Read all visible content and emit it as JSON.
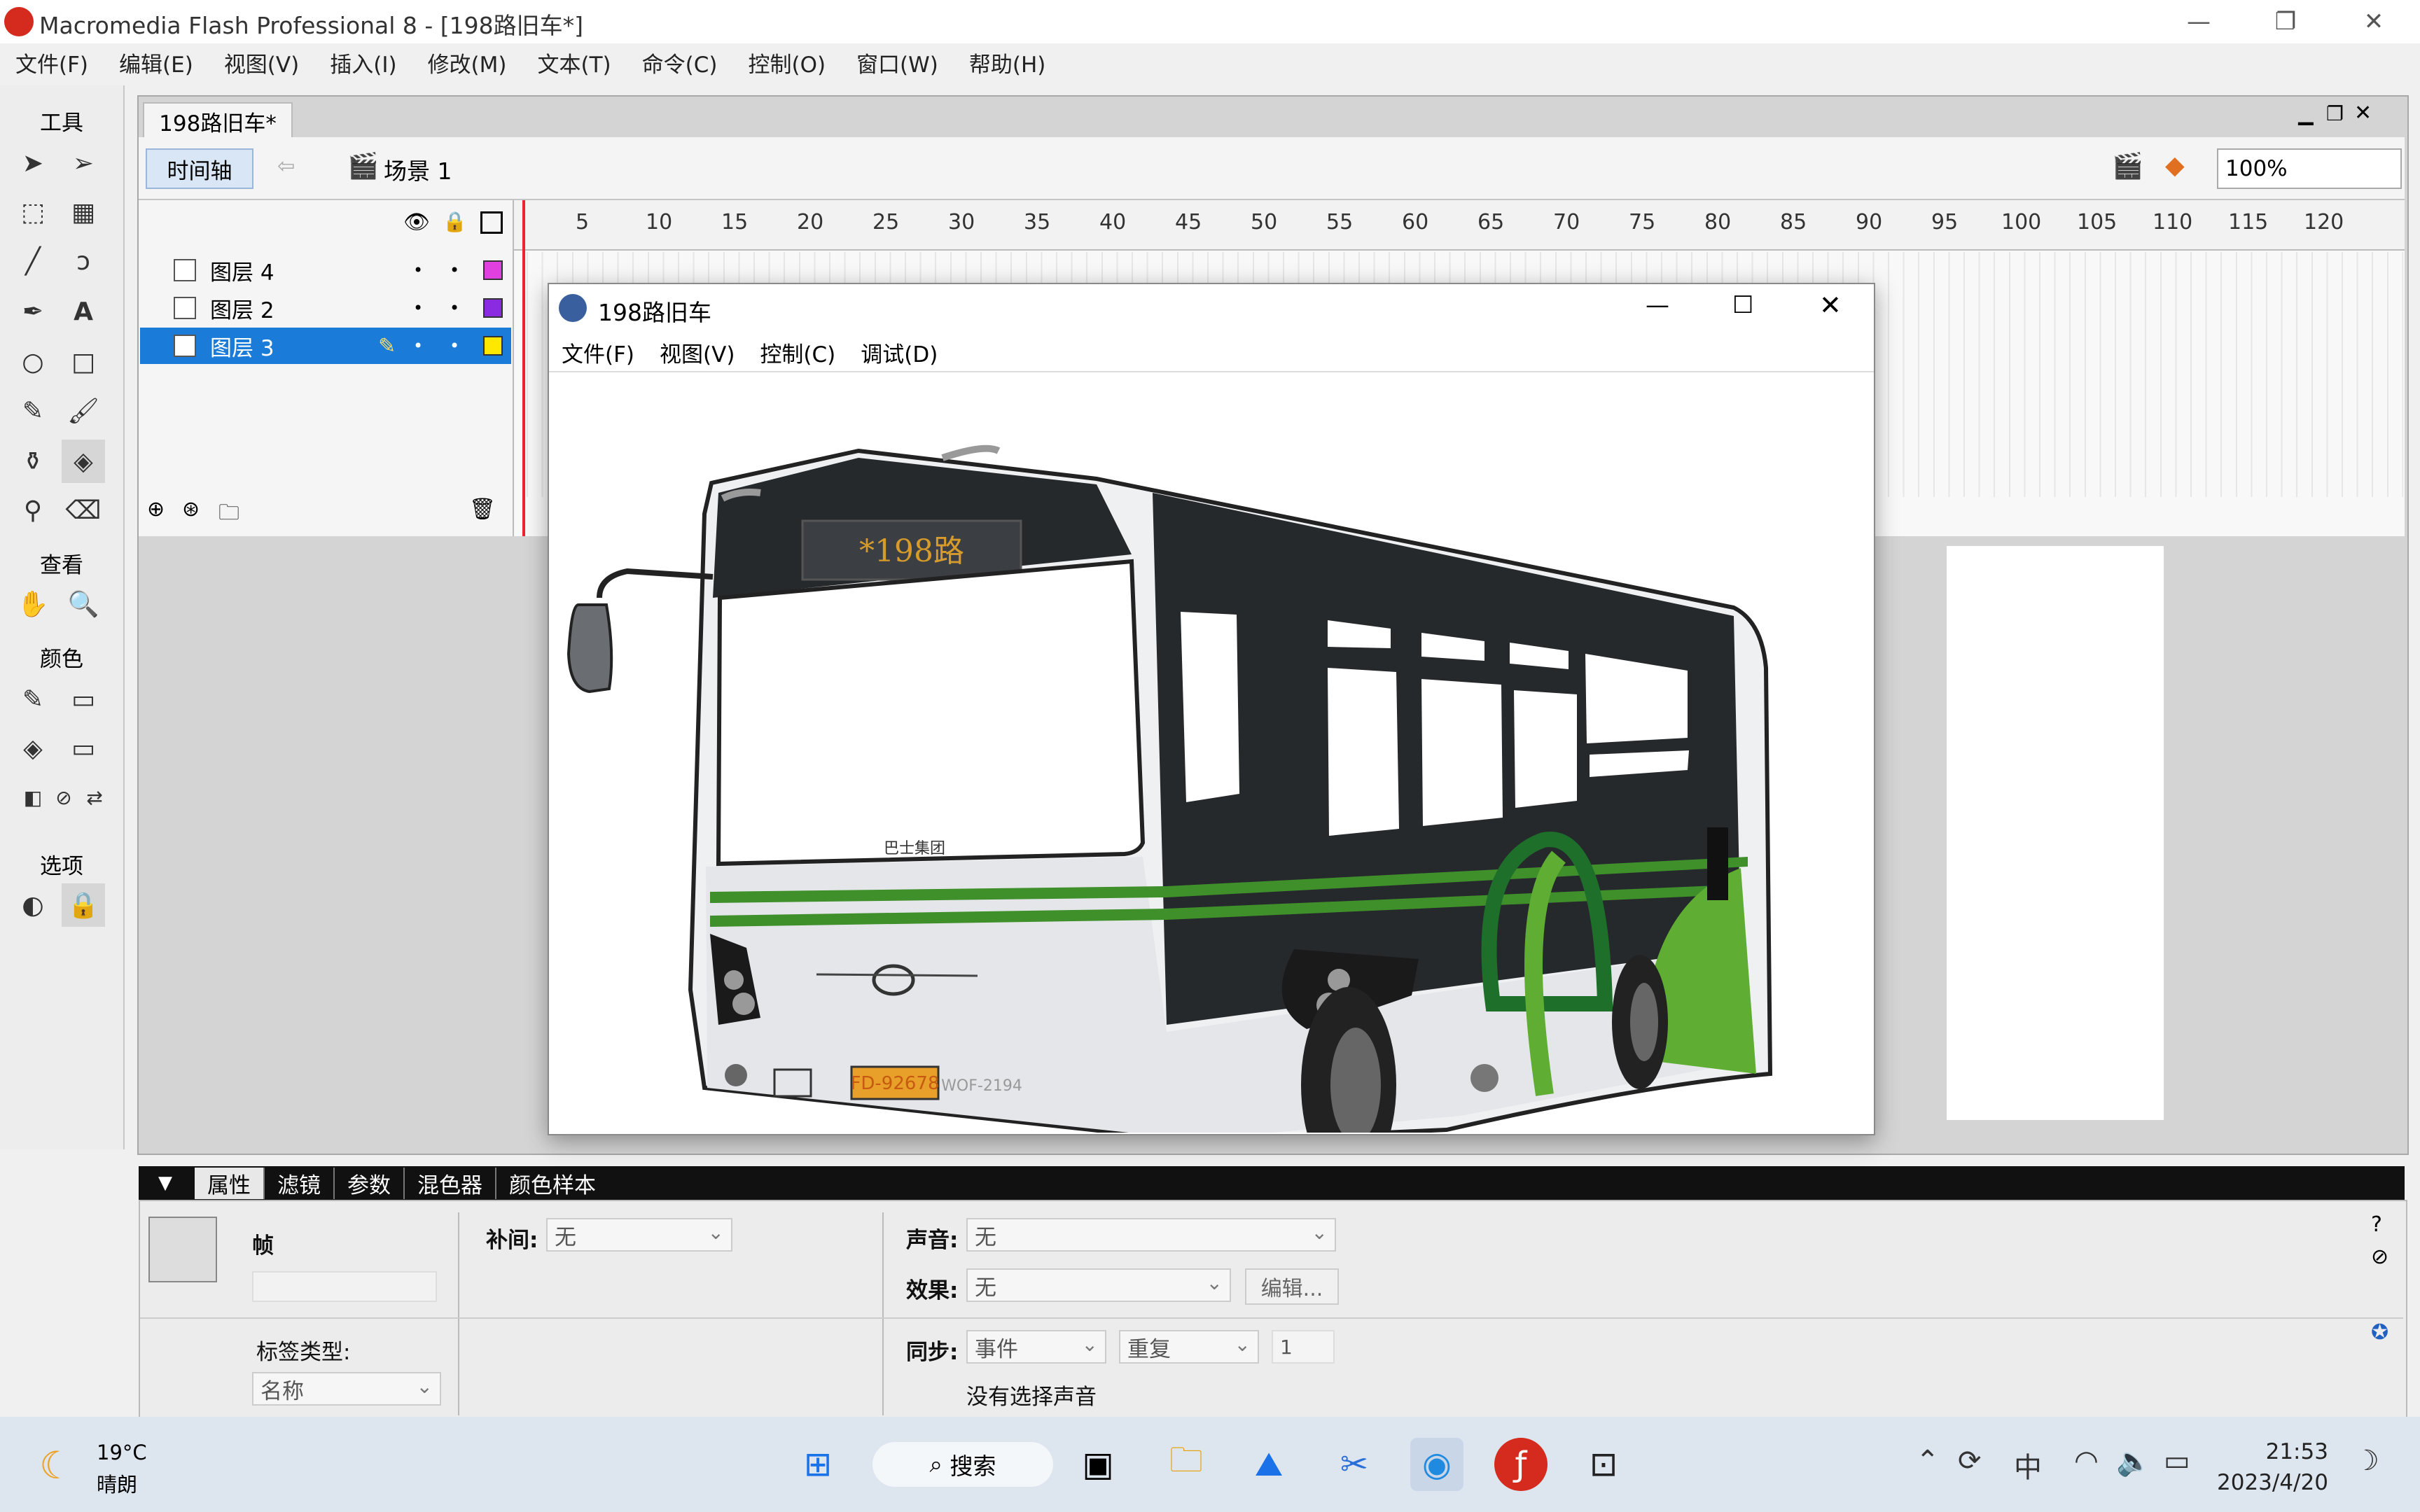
{
  "window": {
    "title": "Macromedia Flash Professional 8 - [198路旧车*]"
  },
  "menubar": [
    "文件(F)",
    "编辑(E)",
    "视图(V)",
    "插入(I)",
    "修改(M)",
    "文本(T)",
    "命令(C)",
    "控制(O)",
    "窗口(W)",
    "帮助(H)"
  ],
  "tools": {
    "header_tools": "工具",
    "header_view": "查看",
    "header_colors": "颜色",
    "header_options": "选项"
  },
  "document": {
    "tab": "198路旧车*",
    "timeline_button": "时间轴",
    "scene": "场景 1",
    "zoom": "100%"
  },
  "timeline": {
    "ruler": [
      "5",
      "10",
      "15",
      "20",
      "25",
      "30",
      "35",
      "40",
      "45",
      "50",
      "55",
      "60",
      "65",
      "70",
      "75",
      "80",
      "85",
      "90",
      "95",
      "100",
      "105",
      "110",
      "115",
      "120"
    ],
    "layers": [
      {
        "name": "图层 4",
        "color": "#e040e0",
        "selected": false
      },
      {
        "name": "图层 2",
        "color": "#8a2be2",
        "selected": false
      },
      {
        "name": "图层 3",
        "color": "#ffe800",
        "selected": true
      }
    ]
  },
  "player": {
    "title": "198路旧车",
    "menu": [
      "文件(F)",
      "视图(V)",
      "控制(C)",
      "调试(D)"
    ],
    "bus": {
      "sign": "*198路",
      "plate": "FD-92678",
      "body_text": "巴士集团",
      "rear_text": "WOF-2194"
    }
  },
  "properties": {
    "tabs": [
      "属性",
      "滤镜",
      "参数",
      "混色器",
      "颜色样本"
    ],
    "frame_label": "帧",
    "tween_label": "补间:",
    "tween_value": "无",
    "label_type_label": "标签类型:",
    "label_type_value": "名称",
    "sound_label": "声音:",
    "sound_value": "无",
    "effect_label": "效果:",
    "effect_value": "无",
    "edit_button": "编辑...",
    "sync_label": "同步:",
    "sync_value": "事件",
    "repeat_value": "重复",
    "repeat_count": "1",
    "no_sound": "没有选择声音"
  },
  "taskbar": {
    "weather_temp": "19°C",
    "weather_desc": "晴朗",
    "search": "搜索",
    "ime": "中",
    "time": "21:53",
    "date": "2023/4/20"
  }
}
